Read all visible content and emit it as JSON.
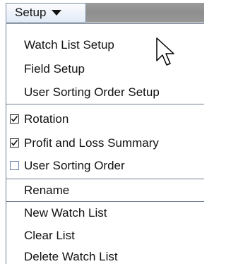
{
  "menubar": {
    "setup_label": "Setup"
  },
  "menu": {
    "group1": [
      "Watch List Setup",
      "Field Setup",
      "User Sorting Order Setup"
    ],
    "toggles": [
      {
        "label": "Rotation",
        "checked": true
      },
      {
        "label": "Profit and Loss Summary",
        "checked": true
      },
      {
        "label": "User Sorting Order",
        "checked": false
      }
    ],
    "group3": [
      "Rename"
    ],
    "group4": [
      "New Watch List",
      "Clear List",
      "Delete Watch List"
    ]
  }
}
